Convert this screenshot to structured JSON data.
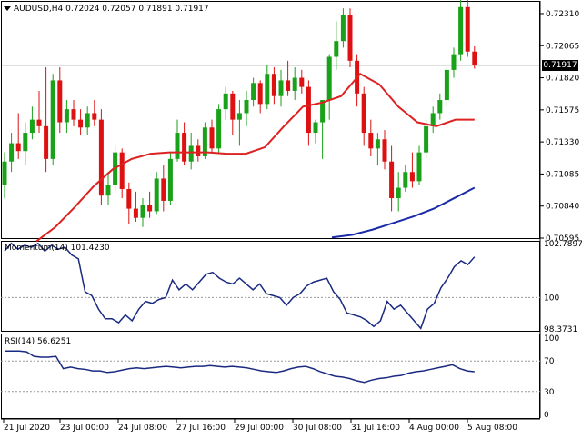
{
  "main_header": {
    "symbol_tf": "AUDUSD,H4",
    "open": "0.72024",
    "high": "0.72057",
    "low": "0.71891",
    "close": "0.71917"
  },
  "price_axis": [
    "0.72310",
    "0.72065",
    "0.71820",
    "0.71575",
    "0.71330",
    "0.71085",
    "0.70840",
    "0.70595"
  ],
  "current_price": "0.71917",
  "momentum_header": "Momentum(14) 101.4230",
  "momentum_axis": [
    "102.7897",
    "100",
    "98.3731"
  ],
  "rsi_header": "RSI(14) 56.6251",
  "rsi_axis": [
    "100",
    "70",
    "30",
    "0"
  ],
  "time_axis": [
    "21 Jul 2020",
    "23 Jul 00:00",
    "24 Jul 08:00",
    "27 Jul 16:00",
    "29 Jul 00:00",
    "30 Jul 08:00",
    "31 Jul 16:00",
    "4 Aug 00:00",
    "5 Aug 08:00"
  ],
  "colors": {
    "bull": "#1aa11a",
    "bear": "#dd1111",
    "ma_red": "#dd2222",
    "ma_blue": "#1a2aa8",
    "indicator": "#1a2a80"
  },
  "chart_data": [
    {
      "type": "candlestick",
      "title": "AUDUSD,H4",
      "candles": [
        [
          0.71,
          0.7125,
          0.709,
          0.7118
        ],
        [
          0.7118,
          0.714,
          0.711,
          0.7132
        ],
        [
          0.7132,
          0.7155,
          0.712,
          0.7126
        ],
        [
          0.7126,
          0.7148,
          0.7115,
          0.714
        ],
        [
          0.714,
          0.716,
          0.7135,
          0.715
        ],
        [
          0.715,
          0.7172,
          0.714,
          0.7145
        ],
        [
          0.7145,
          0.719,
          0.711,
          0.712
        ],
        [
          0.712,
          0.7185,
          0.7115,
          0.718
        ],
        [
          0.718,
          0.719,
          0.714,
          0.7148
        ],
        [
          0.7148,
          0.7165,
          0.714,
          0.7158
        ],
        [
          0.7158,
          0.7165,
          0.7145,
          0.715
        ],
        [
          0.715,
          0.7158,
          0.7138,
          0.7144
        ],
        [
          0.7144,
          0.716,
          0.7138,
          0.7155
        ],
        [
          0.7155,
          0.7165,
          0.7145,
          0.715
        ],
        [
          0.715,
          0.7158,
          0.7085,
          0.7092
        ],
        [
          0.7092,
          0.711,
          0.7085,
          0.71
        ],
        [
          0.71,
          0.713,
          0.7095,
          0.7125
        ],
        [
          0.7125,
          0.7128,
          0.709,
          0.7097
        ],
        [
          0.7097,
          0.7102,
          0.707,
          0.7082
        ],
        [
          0.7082,
          0.7095,
          0.7072,
          0.7075
        ],
        [
          0.7075,
          0.709,
          0.7068,
          0.7085
        ],
        [
          0.7085,
          0.7095,
          0.7075,
          0.708
        ],
        [
          0.708,
          0.711,
          0.7078,
          0.7105
        ],
        [
          0.7105,
          0.7115,
          0.708,
          0.7088
        ],
        [
          0.7088,
          0.7125,
          0.7085,
          0.712
        ],
        [
          0.712,
          0.715,
          0.7118,
          0.714
        ],
        [
          0.714,
          0.7148,
          0.7115,
          0.7118
        ],
        [
          0.7118,
          0.714,
          0.7112,
          0.713
        ],
        [
          0.713,
          0.7135,
          0.7118,
          0.7122
        ],
        [
          0.7122,
          0.7148,
          0.712,
          0.7144
        ],
        [
          0.7144,
          0.715,
          0.7125,
          0.7128
        ],
        [
          0.7128,
          0.7162,
          0.7125,
          0.7158
        ],
        [
          0.7158,
          0.7175,
          0.715,
          0.717
        ],
        [
          0.717,
          0.7172,
          0.7138,
          0.715
        ],
        [
          0.715,
          0.7165,
          0.713,
          0.7155
        ],
        [
          0.7155,
          0.7172,
          0.7145,
          0.7165
        ],
        [
          0.7165,
          0.7182,
          0.716,
          0.7178
        ],
        [
          0.7178,
          0.718,
          0.7155,
          0.7162
        ],
        [
          0.7162,
          0.7192,
          0.7158,
          0.7185
        ],
        [
          0.7185,
          0.719,
          0.7162,
          0.7168
        ],
        [
          0.7168,
          0.7188,
          0.716,
          0.718
        ],
        [
          0.718,
          0.7195,
          0.7168,
          0.7172
        ],
        [
          0.7172,
          0.719,
          0.7165,
          0.7182
        ],
        [
          0.7182,
          0.7188,
          0.717,
          0.7175
        ],
        [
          0.7175,
          0.718,
          0.713,
          0.714
        ],
        [
          0.714,
          0.715,
          0.7132,
          0.7148
        ],
        [
          0.7148,
          0.7162,
          0.712,
          0.7165
        ],
        [
          0.7165,
          0.72,
          0.715,
          0.7198
        ],
        [
          0.7198,
          0.7225,
          0.7188,
          0.721
        ],
        [
          0.721,
          0.7235,
          0.7205,
          0.723
        ],
        [
          0.723,
          0.7235,
          0.719,
          0.7195
        ],
        [
          0.7195,
          0.72,
          0.716,
          0.717
        ],
        [
          0.717,
          0.7175,
          0.713,
          0.714
        ],
        [
          0.714,
          0.715,
          0.7122,
          0.7128
        ],
        [
          0.7128,
          0.714,
          0.7115,
          0.7135
        ],
        [
          0.7135,
          0.7142,
          0.7112,
          0.7118
        ],
        [
          0.7118,
          0.713,
          0.708,
          0.709
        ],
        [
          0.709,
          0.711,
          0.708,
          0.7098
        ],
        [
          0.7098,
          0.7115,
          0.7095,
          0.711
        ],
        [
          0.711,
          0.7125,
          0.7098,
          0.7103
        ],
        [
          0.7103,
          0.713,
          0.71,
          0.7125
        ],
        [
          0.7125,
          0.715,
          0.712,
          0.7145
        ],
        [
          0.7145,
          0.716,
          0.714,
          0.7155
        ],
        [
          0.7155,
          0.717,
          0.715,
          0.7165
        ],
        [
          0.7165,
          0.719,
          0.716,
          0.7188
        ],
        [
          0.7188,
          0.7205,
          0.7182,
          0.72
        ],
        [
          0.72,
          0.7242,
          0.7195,
          0.7236
        ],
        [
          0.7236,
          0.725,
          0.7198,
          0.7202
        ],
        [
          0.7202,
          0.7206,
          0.7189,
          0.7192
        ]
      ],
      "ma_red": [
        0.7057,
        0.7068,
        0.7083,
        0.7099,
        0.7112,
        0.712,
        0.7124,
        0.7125,
        0.7125,
        0.7125,
        0.7124,
        0.7124,
        0.7129,
        0.7145,
        0.716,
        0.7163,
        0.7168,
        0.7185,
        0.7177,
        0.716,
        0.7148,
        0.7145,
        0.715,
        0.715
      ],
      "ma_blue": [
        0.706,
        0.7062,
        0.7066,
        0.7071,
        0.7076,
        0.7082,
        0.709,
        0.7098
      ],
      "ylim": [
        0.70595,
        0.724
      ]
    },
    {
      "type": "line",
      "title": "Momentum(14) 101.4230",
      "values": [
        102.4,
        102.8,
        102.5,
        102.7,
        102.6,
        102.8,
        102.4,
        102.7,
        102.5,
        102.6,
        102.2,
        102.0,
        100.3,
        100.1,
        99.4,
        98.9,
        98.9,
        98.7,
        99.1,
        98.8,
        99.4,
        99.8,
        99.7,
        99.9,
        100.0,
        100.9,
        100.4,
        100.7,
        100.4,
        100.8,
        101.2,
        101.3,
        101.0,
        100.8,
        100.7,
        101.0,
        100.7,
        100.4,
        100.7,
        100.2,
        100.1,
        100.0,
        99.6,
        100.0,
        100.2,
        100.6,
        100.8,
        100.9,
        101.0,
        100.3,
        99.9,
        99.2,
        99.1,
        99.0,
        98.8,
        98.5,
        98.8,
        99.8,
        99.4,
        99.6,
        99.2,
        98.8,
        98.4,
        99.4,
        99.7,
        100.5,
        101.0,
        101.6,
        101.9,
        101.7,
        102.1
      ],
      "ylim": [
        98.3731,
        102.7897
      ]
    },
    {
      "type": "line",
      "title": "RSI(14) 56.6251",
      "levels": [
        70,
        30
      ],
      "values": [
        83,
        83,
        83,
        82,
        76,
        75,
        75,
        76,
        60,
        62,
        60,
        59,
        57,
        57,
        55,
        56,
        58,
        60,
        61,
        60,
        61,
        62,
        63,
        62,
        61,
        62,
        63,
        63,
        64,
        63,
        62,
        63,
        62,
        61,
        59,
        57,
        56,
        55,
        57,
        60,
        62,
        63,
        60,
        56,
        53,
        50,
        49,
        47,
        44,
        42,
        45,
        47,
        48,
        50,
        51,
        54,
        56,
        57,
        59,
        61,
        63,
        65,
        60,
        57,
        56
      ],
      "ylim": [
        0,
        100
      ]
    }
  ]
}
